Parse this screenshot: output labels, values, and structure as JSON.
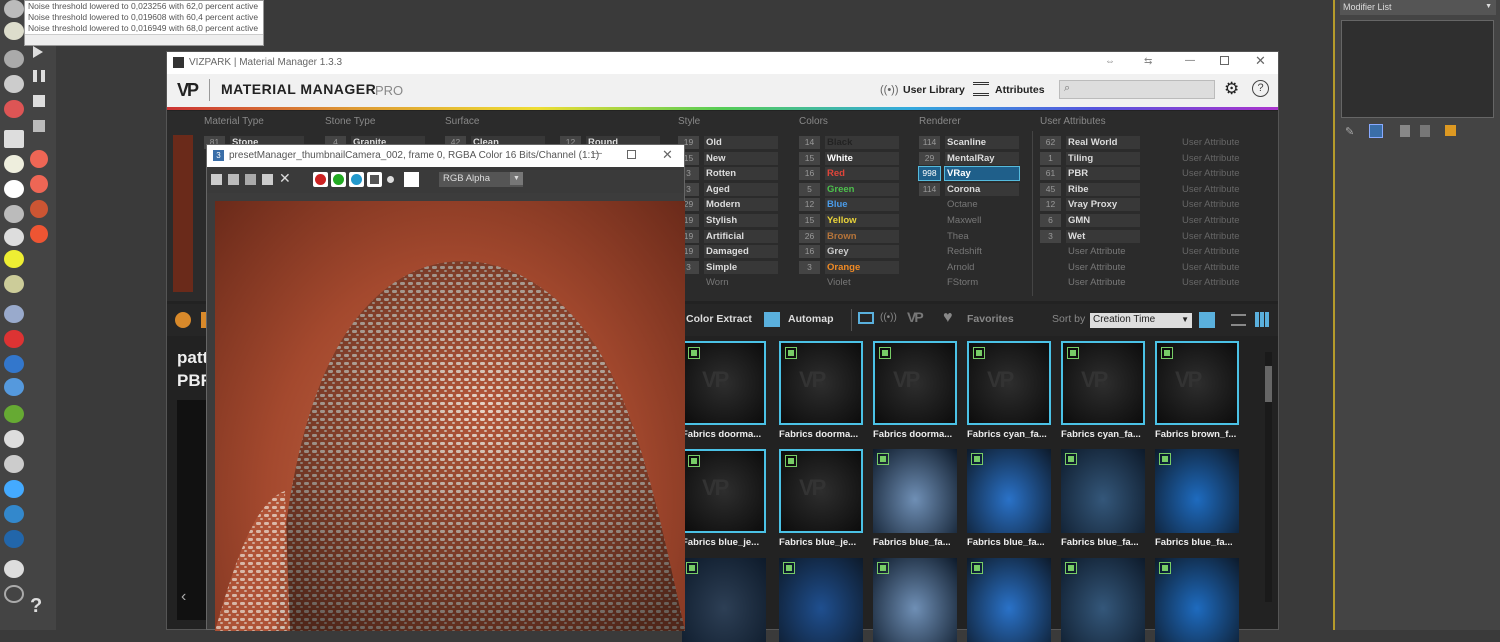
{
  "console": {
    "lines": [
      "Noise threshold lowered to 0,023256 with 62,0 percent active",
      "Noise threshold lowered to 0,019608 with 60,4 percent active",
      "Noise threshold lowered to 0,016949 with 68,0 percent active"
    ]
  },
  "right_panel": {
    "modifier_list": "Modifier List"
  },
  "material_manager": {
    "window_title": "VIZPARK | Material Manager 1.3.3",
    "brand": "MATERIAL MANAGER",
    "brand_suffix": "PRO",
    "user_library": "User Library",
    "attributes": "Attributes",
    "filter_columns": {
      "material_type": {
        "title": "Material Type",
        "items": [
          {
            "count": "81",
            "label": "Stone"
          }
        ]
      },
      "stone_type": {
        "title": "Stone Type",
        "items": [
          {
            "count": "4",
            "label": "Granite"
          }
        ]
      },
      "surface": {
        "title": "Surface",
        "items": [
          {
            "count": "42",
            "label": "Clean"
          },
          {
            "count": "12",
            "label": "Round"
          }
        ]
      },
      "style": {
        "title": "Style",
        "items": [
          {
            "count": "19",
            "label": "Old"
          },
          {
            "count": "15",
            "label": "New"
          },
          {
            "count": "3",
            "label": "Rotten"
          },
          {
            "count": "3",
            "label": "Aged"
          },
          {
            "count": "29",
            "label": "Modern"
          },
          {
            "count": "19",
            "label": "Stylish"
          },
          {
            "count": "19",
            "label": "Artificial"
          },
          {
            "count": "19",
            "label": "Damaged"
          },
          {
            "count": "3",
            "label": "Simple"
          },
          {
            "count": "",
            "label": "Worn"
          }
        ]
      },
      "colors": {
        "title": "Colors",
        "items": [
          {
            "count": "14",
            "label": "Black",
            "color": "#222222"
          },
          {
            "count": "15",
            "label": "White",
            "color": "#ffffff"
          },
          {
            "count": "16",
            "label": "Red",
            "color": "#e0453a"
          },
          {
            "count": "5",
            "label": "Green",
            "color": "#4cc04c"
          },
          {
            "count": "12",
            "label": "Blue",
            "color": "#4a9be8"
          },
          {
            "count": "15",
            "label": "Yellow",
            "color": "#e8d23a"
          },
          {
            "count": "26",
            "label": "Brown",
            "color": "#b5743a"
          },
          {
            "count": "16",
            "label": "Grey",
            "color": "#cccccc"
          },
          {
            "count": "3",
            "label": "Orange",
            "color": "#f08a24"
          },
          {
            "count": "",
            "label": "Violet",
            "color": "#777777"
          }
        ]
      },
      "renderer": {
        "title": "Renderer",
        "items": [
          {
            "count": "114",
            "label": "Scanline"
          },
          {
            "count": "29",
            "label": "MentalRay"
          },
          {
            "count": "998",
            "label": "VRay"
          },
          {
            "count": "114",
            "label": "Corona"
          },
          {
            "count": "",
            "label": "Octane"
          },
          {
            "count": "",
            "label": "Maxwell"
          },
          {
            "count": "",
            "label": "Thea"
          },
          {
            "count": "",
            "label": "Redshift"
          },
          {
            "count": "",
            "label": "Arnold"
          },
          {
            "count": "",
            "label": "FStorm"
          }
        ]
      },
      "user_attributes": {
        "title": "User Attributes",
        "items": [
          {
            "count": "62",
            "label": "Real World"
          },
          {
            "count": "1",
            "label": "Tiling"
          },
          {
            "count": "61",
            "label": "PBR"
          },
          {
            "count": "45",
            "label": "Ribe"
          },
          {
            "count": "12",
            "label": "Vray Proxy"
          },
          {
            "count": "6",
            "label": "GMN"
          },
          {
            "count": "3",
            "label": "Wet"
          },
          {
            "count": "",
            "label": "User Attribute"
          },
          {
            "count": "",
            "label": "User Attribute"
          },
          {
            "count": "",
            "label": "User Attribute"
          }
        ]
      },
      "user_attributes_2": {
        "items": [
          "User Attribute",
          "User Attribute",
          "User Attribute",
          "User Attribute",
          "User Attribute",
          "User Attribute",
          "User Attribute",
          "User Attribute",
          "User Attribute",
          "User Attribute"
        ]
      }
    },
    "toolbar": {
      "color_extract": "Color Extract",
      "automap": "Automap",
      "favorites": "Favorites",
      "sort_by": "Sort by",
      "sort_value": "Creation Time"
    },
    "left_text": [
      "patt",
      "PBR"
    ],
    "grid": {
      "row1": [
        "Fabrics doorma...",
        "Fabrics doorma...",
        "Fabrics doorma...",
        "Fabrics cyan_fa...",
        "Fabrics cyan_fa...",
        "Fabrics brown_f..."
      ],
      "row2": [
        "Fabrics blue_je...",
        "Fabrics blue_je...",
        "Fabrics blue_fa...",
        "Fabrics blue_fa...",
        "Fabrics blue_fa...",
        "Fabrics blue_fa..."
      ]
    }
  },
  "frame_buffer": {
    "title": "presetManager_thumbnailCamera_002, frame 0, RGBA Color 16 Bits/Channel (1:1)",
    "channel": "RGB Alpha"
  }
}
